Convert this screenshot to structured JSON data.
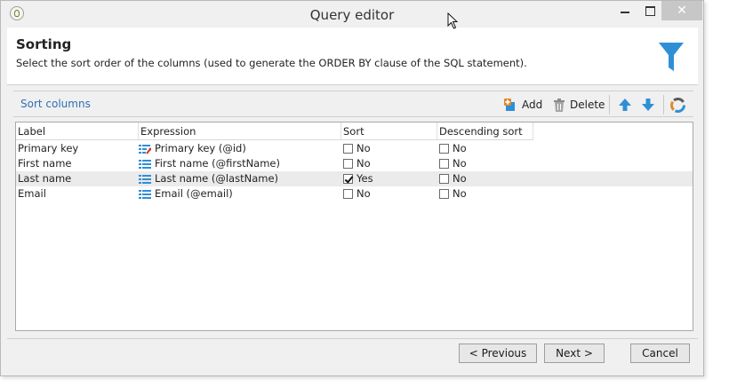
{
  "window": {
    "title": "Query editor"
  },
  "header": {
    "title": "Sorting",
    "subtitle": "Select the sort order of the columns (used to generate the ORDER BY clause of the SQL statement)."
  },
  "toolbar": {
    "label": "Sort columns",
    "add_label": "Add",
    "delete_label": "Delete"
  },
  "grid": {
    "columns": [
      "Label",
      "Expression",
      "Sort",
      "Descending sort"
    ],
    "rows": [
      {
        "label": "Primary key",
        "expression": "Primary key (@id)",
        "expression_icon": "key-field-icon",
        "sort": "No",
        "sort_checked": false,
        "desc": "No",
        "desc_checked": false
      },
      {
        "label": "First name",
        "expression": "First name (@firstName)",
        "expression_icon": "field-icon",
        "sort": "No",
        "sort_checked": false,
        "desc": "No",
        "desc_checked": false
      },
      {
        "label": "Last name",
        "expression": "Last name (@lastName)",
        "expression_icon": "field-icon",
        "sort": "Yes",
        "sort_checked": true,
        "desc": "No",
        "desc_checked": false
      },
      {
        "label": "Email",
        "expression": "Email (@email)",
        "expression_icon": "field-icon",
        "sort": "No",
        "sort_checked": false,
        "desc": "No",
        "desc_checked": false
      }
    ]
  },
  "footer": {
    "previous_label": "< Previous",
    "next_label": "Next >",
    "cancel_label": "Cancel"
  },
  "colors": {
    "accent": "#2f8fd6",
    "link": "#2f6fb5",
    "add_icon": "#e2882c",
    "delete_icon": "#8a8a8a"
  }
}
